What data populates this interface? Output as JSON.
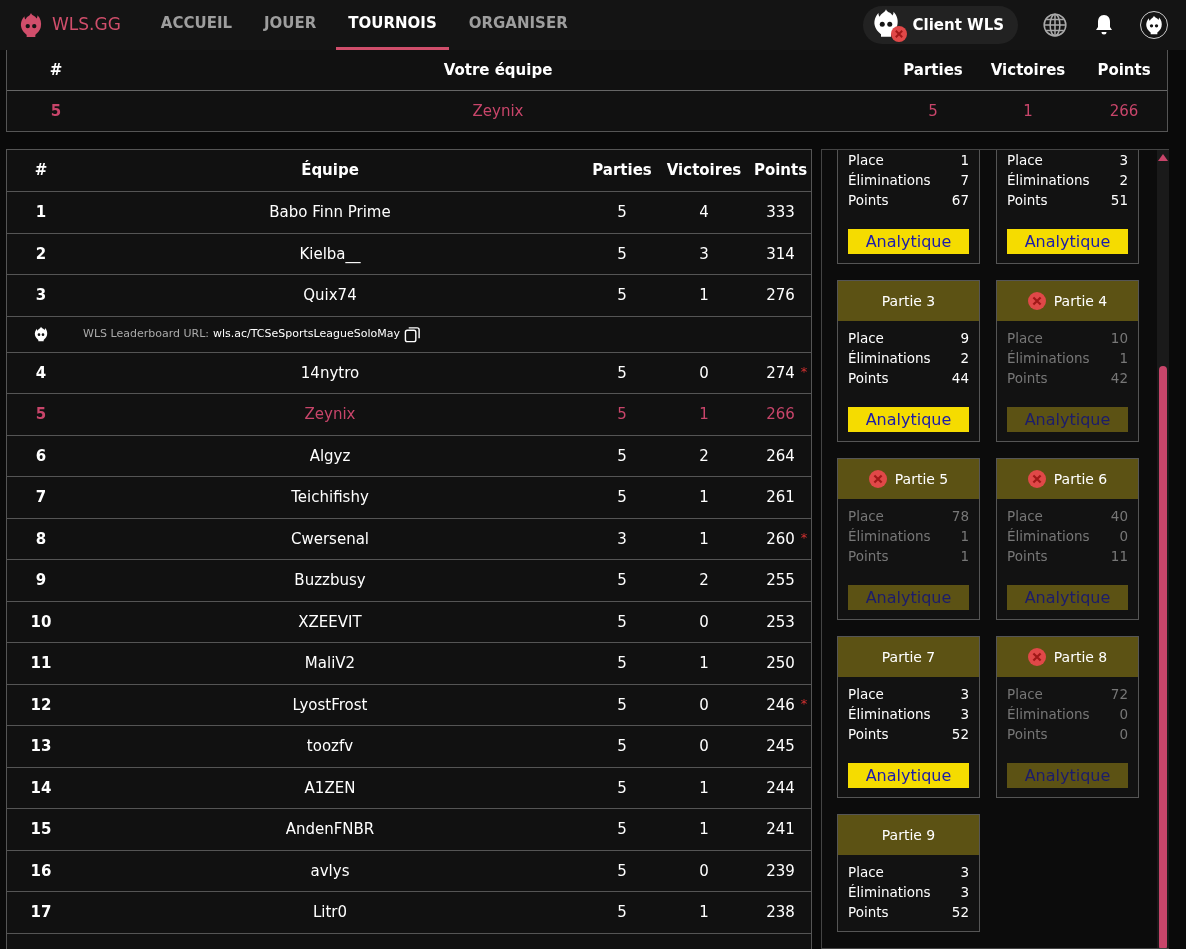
{
  "navbar": {
    "brand": "WLS.GG",
    "links": [
      {
        "label": "ACCUEIL",
        "selected": false
      },
      {
        "label": "JOUER",
        "selected": false
      },
      {
        "label": "TOURNOIS",
        "selected": true
      },
      {
        "label": "ORGANISER",
        "selected": false
      }
    ],
    "client_button": {
      "label": "Client WLS",
      "disconnected": true
    }
  },
  "my_team": {
    "columns": [
      "#",
      "Votre équipe",
      "Parties",
      "Victoires",
      "Points"
    ],
    "row": {
      "rank": "5",
      "team": "Zeynix",
      "games": "5",
      "wins": "1",
      "points": "266"
    }
  },
  "leaderboard": {
    "columns": [
      "#",
      "Équipe",
      "Parties",
      "Victoires",
      "Points"
    ],
    "rows": [
      {
        "kind": "team",
        "rank": "1",
        "team": "Babo Finn Prime",
        "games": "5",
        "wins": "4",
        "points": "333",
        "highlighted": false
      },
      {
        "kind": "team",
        "rank": "2",
        "team": "Kielba__",
        "games": "5",
        "wins": "3",
        "points": "314",
        "highlighted": false
      },
      {
        "kind": "team",
        "rank": "3",
        "team": "Quix74",
        "games": "5",
        "wins": "1",
        "points": "276",
        "highlighted": false
      },
      {
        "kind": "url",
        "label": "WLS Leaderboard URL:",
        "url": "wls.ac/TCSeSportsLeagueSoloMay"
      },
      {
        "kind": "team",
        "rank": "4",
        "team": "14nytro",
        "games": "5",
        "wins": "0",
        "points": "274",
        "mark": "*",
        "highlighted": false
      },
      {
        "kind": "team",
        "rank": "5",
        "team": "Zeynix",
        "games": "5",
        "wins": "1",
        "points": "266",
        "highlighted": true
      },
      {
        "kind": "team",
        "rank": "6",
        "team": "Algyz",
        "games": "5",
        "wins": "2",
        "points": "264",
        "highlighted": false
      },
      {
        "kind": "team",
        "rank": "7",
        "team": "Teichifishy",
        "games": "5",
        "wins": "1",
        "points": "261",
        "highlighted": false
      },
      {
        "kind": "team",
        "rank": "8",
        "team": "Cwersenal",
        "games": "3",
        "wins": "1",
        "points": "260",
        "mark": "*",
        "highlighted": false
      },
      {
        "kind": "team",
        "rank": "9",
        "team": "Buzzbusy",
        "games": "5",
        "wins": "2",
        "points": "255",
        "highlighted": false
      },
      {
        "kind": "team",
        "rank": "10",
        "team": "XZEEVIT",
        "games": "5",
        "wins": "0",
        "points": "253",
        "highlighted": false
      },
      {
        "kind": "team",
        "rank": "11",
        "team": "MaliV2",
        "games": "5",
        "wins": "1",
        "points": "250",
        "highlighted": false
      },
      {
        "kind": "team",
        "rank": "12",
        "team": "LyostFrost",
        "games": "5",
        "wins": "0",
        "points": "246",
        "mark": "*",
        "highlighted": false
      },
      {
        "kind": "team",
        "rank": "13",
        "team": "toozfv",
        "games": "5",
        "wins": "0",
        "points": "245",
        "highlighted": false
      },
      {
        "kind": "team",
        "rank": "14",
        "team": "A1ZEN",
        "games": "5",
        "wins": "1",
        "points": "244",
        "highlighted": false
      },
      {
        "kind": "team",
        "rank": "15",
        "team": "AndenFNBR",
        "games": "5",
        "wins": "1",
        "points": "241",
        "highlighted": false
      },
      {
        "kind": "team",
        "rank": "16",
        "team": "avlys",
        "games": "5",
        "wins": "0",
        "points": "239",
        "highlighted": false
      },
      {
        "kind": "team",
        "rank": "17",
        "team": "Litr0",
        "games": "5",
        "wins": "1",
        "points": "238",
        "highlighted": false
      }
    ]
  },
  "games": [
    {
      "eliminated": false,
      "stats": [
        [
          "Place",
          "1"
        ],
        [
          "Éliminations",
          "7"
        ],
        [
          "Points",
          "67"
        ]
      ],
      "button": "Analytique"
    },
    {
      "eliminated": false,
      "stats": [
        [
          "Place",
          "3"
        ],
        [
          "Éliminations",
          "2"
        ],
        [
          "Points",
          "51"
        ]
      ],
      "button": "Analytique"
    },
    {
      "title": "Partie 3",
      "eliminated": false,
      "stats": [
        [
          "Place",
          "9"
        ],
        [
          "Éliminations",
          "2"
        ],
        [
          "Points",
          "44"
        ]
      ],
      "button": "Analytique"
    },
    {
      "title": "Partie 4",
      "eliminated": true,
      "stats": [
        [
          "Place",
          "10"
        ],
        [
          "Éliminations",
          "1"
        ],
        [
          "Points",
          "42"
        ]
      ],
      "button": "Analytique"
    },
    {
      "title": "Partie 5",
      "eliminated": true,
      "stats": [
        [
          "Place",
          "78"
        ],
        [
          "Éliminations",
          "1"
        ],
        [
          "Points",
          "1"
        ]
      ],
      "button": "Analytique"
    },
    {
      "title": "Partie 6",
      "eliminated": true,
      "stats": [
        [
          "Place",
          "40"
        ],
        [
          "Éliminations",
          "0"
        ],
        [
          "Points",
          "11"
        ]
      ],
      "button": "Analytique"
    },
    {
      "title": "Partie 7",
      "eliminated": false,
      "stats": [
        [
          "Place",
          "3"
        ],
        [
          "Éliminations",
          "3"
        ],
        [
          "Points",
          "52"
        ]
      ],
      "button": "Analytique"
    },
    {
      "title": "Partie 8",
      "eliminated": true,
      "stats": [
        [
          "Place",
          "72"
        ],
        [
          "Éliminations",
          "0"
        ],
        [
          "Points",
          "0"
        ]
      ],
      "button": "Analytique"
    },
    {
      "title": "Partie 9",
      "eliminated": false,
      "stats": [
        [
          "Place",
          "3"
        ],
        [
          "Éliminations",
          "3"
        ],
        [
          "Points",
          "52"
        ]
      ]
    }
  ]
}
